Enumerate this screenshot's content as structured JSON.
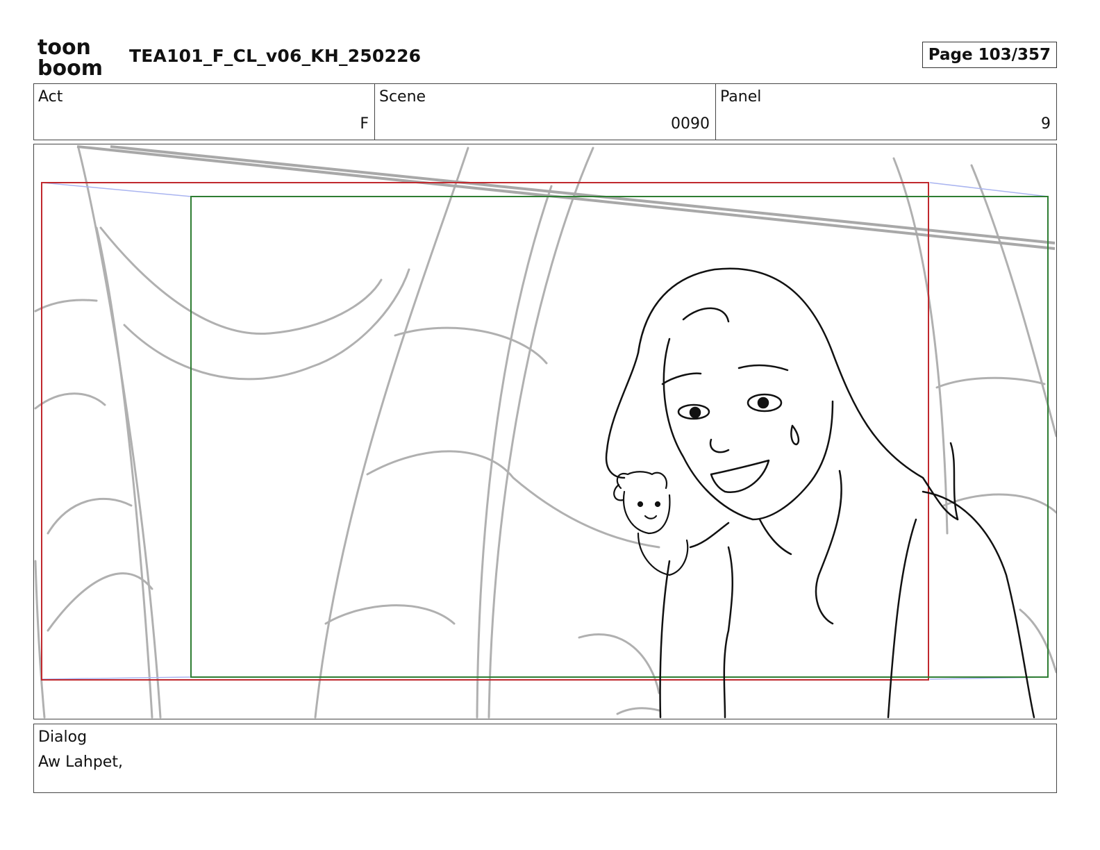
{
  "header": {
    "logo_text_top": "toon",
    "logo_text_bottom": "boom",
    "document_title": "TEA101_F_CL_v06_KH_250226",
    "page_indicator": "Page 103/357"
  },
  "info": {
    "act_label": "Act",
    "act_value": "F",
    "scene_label": "Scene",
    "scene_value": "0090",
    "panel_label": "Panel",
    "panel_value": "9"
  },
  "panel": {
    "frame_colors": {
      "camera_frame_start": "#c0282d",
      "camera_frame_end": "#2e7d32",
      "motion_guide": "#a9b4f0",
      "background_lines": "#b0b0b0",
      "character_lines": "#111111"
    }
  },
  "dialog": {
    "label": "Dialog",
    "text": "Aw Lahpet,"
  }
}
